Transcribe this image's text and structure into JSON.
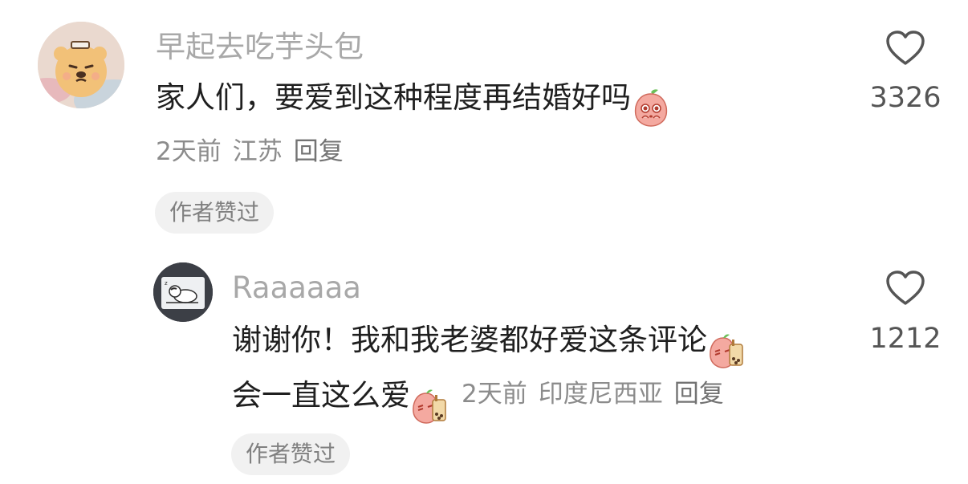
{
  "comment": {
    "username": "早起去吃芋头包",
    "text": "家人们，要爱到这种程度再结婚好吗",
    "emoji": "flushed-peach-emoji",
    "time": "2天前",
    "location": "江苏",
    "reply_label": "回复",
    "author_liked_badge": "作者赞过",
    "like_count": "3326",
    "avatar": "bear-avatar"
  },
  "reply": {
    "username": "Raaaaaa",
    "text_line1": "谢谢你！我和我老婆都好爱这条评论",
    "text_line2": "会一直这么爱",
    "emoji": "peach-bubble-tea-emoji",
    "time": "2天前",
    "location": "印度尼西亚",
    "reply_label": "回复",
    "author_liked_badge": "作者赞过",
    "like_count": "1212",
    "avatar": "sleeping-cartoon-avatar"
  },
  "colors": {
    "username": "#a8a8a8",
    "text": "#1f1f1f",
    "meta": "#8c8c8c",
    "badge_bg": "#f1f1f1",
    "icon": "#555555"
  }
}
